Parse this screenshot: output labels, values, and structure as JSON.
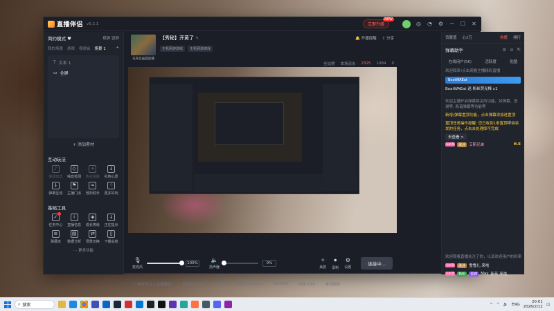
{
  "app": {
    "name": "直播伴侣",
    "version": "v5.2.1",
    "upgrade_label": "立即升级",
    "upgrade_badge": "NEW",
    "top_icons": [
      "headset-icon",
      "bell-icon",
      "settings-icon",
      "minimize-icon",
      "maximize-icon",
      "close-icon"
    ]
  },
  "left_panel": {
    "mode_label": "简约模式 ♥",
    "mode_right": "横屏 竖屏",
    "scene_tabs": [
      "我的场景",
      "游戏",
      "视频会",
      "场景 1"
    ],
    "scenes": [
      {
        "label": "文本 1",
        "selected": false
      },
      {
        "label": "全屏",
        "selected": true
      }
    ],
    "add_material": "+ 添加素材",
    "interactive_title": "互动玩法",
    "interactive_tools": [
      {
        "label": "连线玩法",
        "icon": "mic-icon",
        "dim": true
      },
      {
        "label": "噪音检测",
        "icon": "shield-icon",
        "dim": false
      },
      {
        "label": "热点追踪",
        "icon": "fire-icon",
        "dim": true
      },
      {
        "label": "礼物心愿",
        "icon": "gift-icon",
        "dim": false
      },
      {
        "label": "弹幕互动",
        "icon": "download-icon",
        "dim": false
      },
      {
        "label": "主播门派",
        "icon": "flag-icon",
        "dim": false
      },
      {
        "label": "轻松助手",
        "icon": "link-icon",
        "dim": false
      },
      {
        "label": "更多好玩",
        "icon": "grid-icon",
        "dim": false
      }
    ],
    "basic_title": "基础工具",
    "basic_tools": [
      {
        "label": "任务中心",
        "icon": "check-icon",
        "badge": true
      },
      {
        "label": "直播信息",
        "icon": "info-icon",
        "badge": false
      },
      {
        "label": "成长等级",
        "icon": "medal-icon",
        "badge": false
      },
      {
        "label": "正在提示",
        "icon": "download-icon",
        "badge": false
      },
      {
        "label": "弹幕库",
        "icon": "list-icon",
        "badge": false
      },
      {
        "label": "数据分析",
        "icon": "chart-icon",
        "badge": false
      },
      {
        "label": "场景切换",
        "icon": "switch-icon",
        "badge": false
      },
      {
        "label": "下播总结",
        "icon": "doc-icon",
        "badge": false
      }
    ],
    "more": "更多功能"
  },
  "stream": {
    "cover_label": "已开启画面直播",
    "title": "【秀秘】开黄了",
    "categories": [
      "主机网游游戏",
      "主机网游游戏"
    ],
    "top_actions": [
      "开播提醒",
      "分享"
    ],
    "stats": [
      "全站榜",
      "本场流水",
      "2325",
      "1084",
      "0"
    ]
  },
  "controls": {
    "mic_label": "麦克风",
    "mic_value": "100%",
    "mic_fill": 1.0,
    "speaker_label": "扬声器",
    "speaker_value": "0%",
    "speaker_fill": 0.0,
    "beauty_label": "美颜",
    "record_label": "录制",
    "settings_label": "设置",
    "start_label": "连接中..."
  },
  "status_bar": {
    "items": [
      "你好关注上主播播放!",
      "数据收0Kb/s",
      "FPS:60",
      "丢帧:0(0.00%)",
      "CPU:4%",
      "内存:13%",
      "本月时长"
    ]
  },
  "right_panel": {
    "top_items": [
      "贡献值",
      "心2万",
      "排行"
    ],
    "top_hot": "热度",
    "danmu_title": "弹幕助手",
    "tabs": [
      "在线用户(56)",
      "活跃度",
      "贴图"
    ],
    "counter": "1条/1人",
    "messages": [
      {
        "text": "欢迎回来!点击观看主播精彩直播",
        "style": "gray"
      },
      {
        "text": "欢迎主播开启弹幕相关的功能，如弹幕、答谢等, 和谐弹幕等功能等",
        "style": "gray"
      },
      {
        "text": "新增(弹幕置顶功能，点击弹幕添加进置顶",
        "style": "yellow"
      },
      {
        "text": "置顶任务操作提醒: 您已收到1条置顶平台派发的任务，点击去处理即可完成",
        "style": "yellow"
      }
    ],
    "gift_card": "BoatWAEat 送 粉丝荧光棒 x1",
    "gift_user": "BoatWAEat",
    "go_check": "去查看 >",
    "user_line1": {
      "level": "Lv.3",
      "fan": "歌迷",
      "name": "艾斯兄弟"
    },
    "user_line1_text": "H.E",
    "bottom_msg": "欢迎观看直播关注了你，以及欢迎用户的到来",
    "user_line2": {
      "level": "Lv.3",
      "fan": "歌迷",
      "name": "雪雪儿 来啦"
    },
    "user_line3": {
      "level": "Lv.3",
      "green": "新粉",
      "purple": "贵宾",
      "name": "May",
      "text": "新年 来啦"
    }
  },
  "taskbar": {
    "search_placeholder": "搜索",
    "apps": [
      "explorer",
      "edge",
      "chrome",
      "store",
      "mail",
      "steam",
      "music",
      "vscode",
      "terminal",
      "capcut",
      "browser2",
      "notes",
      "live",
      "game",
      "discord",
      "settings"
    ],
    "tray_lang": "ENG",
    "time": "20:01",
    "date": "2026/2/12"
  },
  "colors": {
    "window_bg": "#1b1e26",
    "panel_bg": "#1f232c",
    "accent_red": "#ff6b5a",
    "accent_yellow": "#ffcc33"
  }
}
